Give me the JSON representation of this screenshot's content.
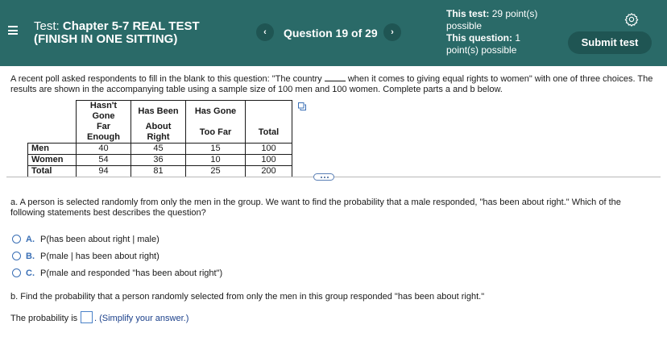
{
  "header": {
    "title_prefix": "Test:",
    "title_name": "Chapter 5-7 REAL TEST",
    "title_line2": "(FINISH IN ONE SITTING)",
    "question_counter": "Question 19 of 29",
    "prev_label": "‹",
    "next_label": "›",
    "test_points_label": "This test:",
    "test_points_value": "29 point(s) possible",
    "question_points_label": "This question:",
    "question_points_value": "1 point(s) possible",
    "submit_label": "Submit test",
    "icons": [
      "menu-icon",
      "gear-icon"
    ],
    "colors": {
      "header_bg": "#2a6a68",
      "button_bg": "#1f5553"
    }
  },
  "question": {
    "intro_part1": "A recent poll asked respondents to fill in the blank to this question: \"The country",
    "intro_part2": "when it comes to giving equal rights to women\" with one of three choices. The results are shown in the accompanying table using a sample size of 100 men and 100 women. Complete parts a and b below.",
    "table": {
      "headers_line1": [
        "Hasn't Gone",
        "Has Been",
        "Has Gone",
        ""
      ],
      "headers_line2": [
        "Far Enough",
        "About Right",
        "Too Far",
        "Total"
      ],
      "rows": [
        {
          "label": "Men",
          "values": [
            "40",
            "45",
            "15",
            "100"
          ]
        },
        {
          "label": "Women",
          "values": [
            "54",
            "36",
            "10",
            "100"
          ]
        },
        {
          "label": "Total",
          "values": [
            "94",
            "81",
            "25",
            "200"
          ]
        }
      ]
    },
    "part_a": "a. A person is selected randomly from only the men in the group. We want to find the probability that a male responded, \"has been about right.\" Which of the following statements best describes the question?",
    "choices": [
      {
        "letter": "A.",
        "text": "P(has been about right | male)"
      },
      {
        "letter": "B.",
        "text": "P(male | has been about right)"
      },
      {
        "letter": "C.",
        "text": "P(male and responded \"has been about right\")"
      }
    ],
    "part_b": "b. Find the probability that a person randomly selected from only the men in this group responded \"has been about right.\"",
    "answer_prefix": "The probability is",
    "answer_value": "",
    "answer_hint": ". (Simplify your answer.)"
  }
}
